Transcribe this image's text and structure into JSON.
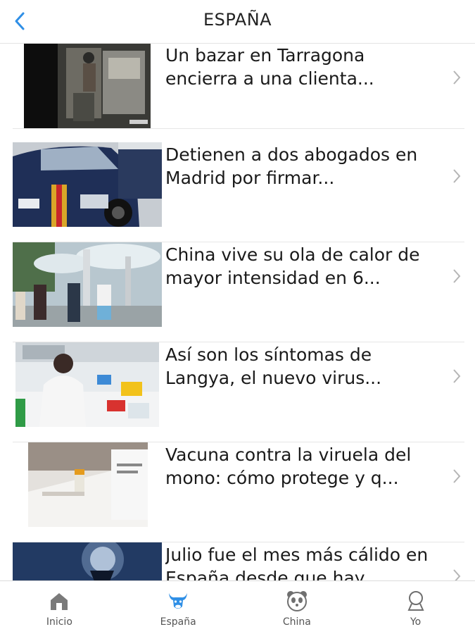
{
  "header": {
    "title": "ESPAÑA",
    "back_icon": "chevron-left-icon",
    "accent": "#2f8fe6"
  },
  "articles": [
    {
      "headline": "Un bazar en Tarragona encierra a una clienta..."
    },
    {
      "headline": "Detienen a dos abogados en Madrid por firmar..."
    },
    {
      "headline": "China vive su ola de calor de mayor intensidad en 6..."
    },
    {
      "headline": "Así son los síntomas de Langya, el nuevo virus..."
    },
    {
      "headline": "Vacuna contra la viruela del mono: cómo protege y q..."
    },
    {
      "headline": "Julio fue el mes más cálido en España desde que hay..."
    }
  ],
  "tabs": [
    {
      "label": "Inicio",
      "icon": "home-icon"
    },
    {
      "label": "España",
      "icon": "bull-icon",
      "active": true
    },
    {
      "label": "China",
      "icon": "panda-icon"
    },
    {
      "label": "Yo",
      "icon": "user-icon"
    }
  ]
}
